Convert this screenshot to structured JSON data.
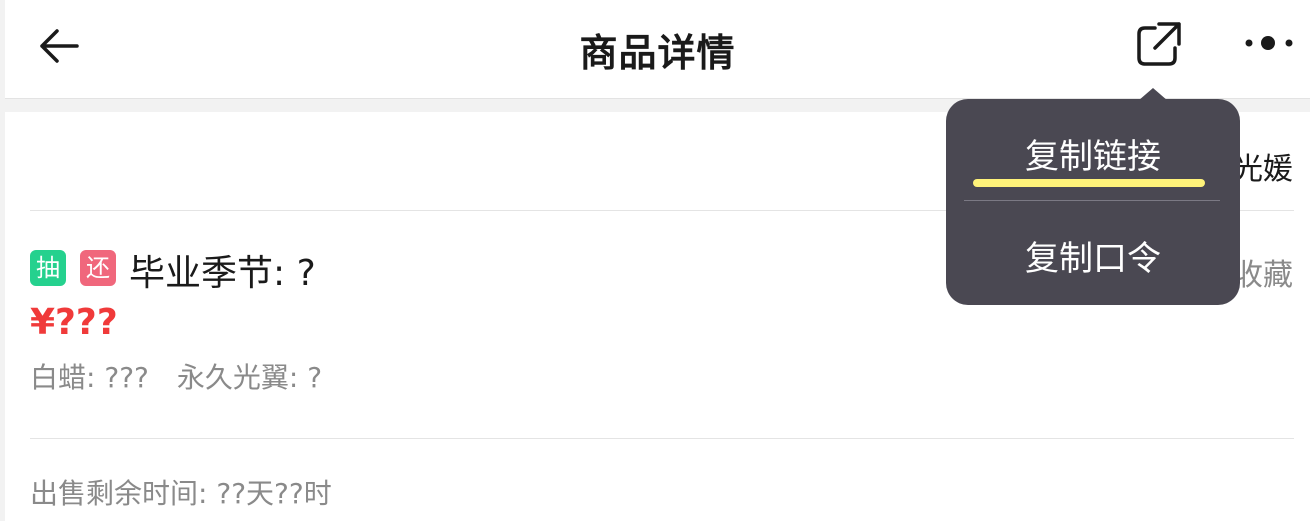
{
  "header": {
    "title": "商品详情",
    "back_icon": "arrow-left-icon",
    "share_icon": "share-external-icon",
    "more_icon": "more-dots-icon"
  },
  "card": {
    "partial_row_text": "光媛",
    "badges": [
      {
        "label": "抽",
        "color": "#25d18e"
      },
      {
        "label": "还",
        "color": "#f0677c"
      }
    ],
    "product_name": "毕业季节: ?",
    "favorites_text": "？？？ 人收藏",
    "price": "¥???",
    "attributes": [
      "白蜡: ???",
      "永久光翼: ?"
    ],
    "remaining_time": "出售剩余时间: ??天??时"
  },
  "share_menu": {
    "items": [
      "复制链接",
      "复制口令"
    ],
    "background": "#4a4852",
    "highlight_color": "#fff37a"
  }
}
